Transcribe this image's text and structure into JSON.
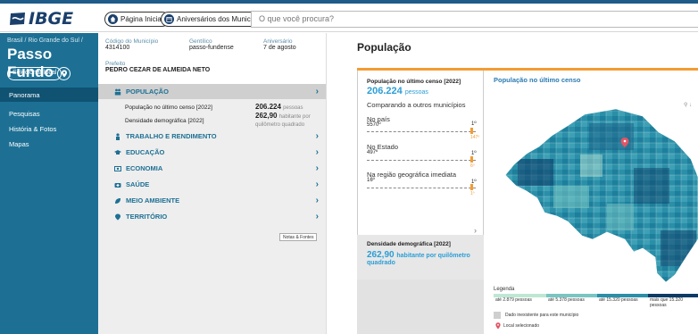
{
  "header": {
    "logo_text": "IBGE",
    "nav_home": "Página Inicial",
    "nav_anniv": "Aniversários dos Municípios",
    "search_placeholder": "O que você procura?"
  },
  "sidebar": {
    "state": "Brasil / Rio Grande do Sul /",
    "city": "Passo Fundo",
    "select_label": "Selecionar local",
    "items": [
      {
        "label": "Panorama"
      },
      {
        "label": "Pesquisas"
      },
      {
        "label": "História & Fotos"
      },
      {
        "label": "Mapas"
      }
    ]
  },
  "info": {
    "code_label": "Código do Município",
    "code_value": "4314100",
    "gentilico_label": "Gentílico",
    "gentilico_value": "passo-fundense",
    "anniv_label": "Aniversário",
    "anniv_value": "7 de agosto",
    "mayor_label": "Prefeito",
    "mayor_value": "PEDRO CEZAR DE ALMEIDA NETO"
  },
  "sections": [
    {
      "label": "POPULAÇÃO",
      "icon": "people-icon"
    },
    {
      "label": "TRABALHO E RENDIMENTO",
      "icon": "worker-icon"
    },
    {
      "label": "EDUCAÇÃO",
      "icon": "graduation-icon"
    },
    {
      "label": "ECONOMIA",
      "icon": "money-icon"
    },
    {
      "label": "SAÚDE",
      "icon": "health-icon"
    },
    {
      "label": "MEIO AMBIENTE",
      "icon": "leaf-icon"
    },
    {
      "label": "TERRITÓRIO",
      "icon": "territory-icon"
    }
  ],
  "population_rows": [
    {
      "label": "População no último censo [2022]",
      "value": "206.224",
      "unit": "pessoas"
    },
    {
      "label": "Densidade demográfica [2022]",
      "value": "262,90",
      "unit": "habitante por quilômetro quadrado"
    }
  ],
  "notes_label": "Notas & Fontes",
  "main": {
    "title": "População",
    "card_title": "População no último censo [2022]",
    "card_value": "206.224",
    "card_unit": "pessoas",
    "compare_title": "Comparando a outros municípios",
    "rankings": [
      {
        "title": "No país",
        "value": "5570º",
        "top": "1º",
        "rank": "147º"
      },
      {
        "title": "No Estado",
        "value": "497º",
        "top": "1º",
        "rank": "6º"
      },
      {
        "title": "Na região geográfica imediata",
        "value": "16º",
        "top": "1º",
        "rank": "1º"
      }
    ],
    "density_title": "Densidade demográfica [2022]",
    "density_value": "262,90",
    "density_unit": "habitante por quilômetro",
    "density_unit2": "quadrado",
    "map_title": "População no último censo"
  },
  "legend": {
    "title": "Legenda",
    "bins": [
      {
        "label": "até 2.879 pessoas",
        "color": "#bfe6d4"
      },
      {
        "label": "até 5.378 pessoas",
        "color": "#78c6c3"
      },
      {
        "label": "até 15.320 pessoas",
        "color": "#2a8fa8"
      },
      {
        "label": "mais que 15.320",
        "label2": "pessoas",
        "color": "#0d3b66"
      }
    ],
    "nodata": "Dado inexistente para este município",
    "selected": "Local selecionado"
  },
  "colors": {
    "sidebar": "#1d7094",
    "accent_orange": "#f39c33",
    "accent_blue": "#2b9ed6"
  }
}
